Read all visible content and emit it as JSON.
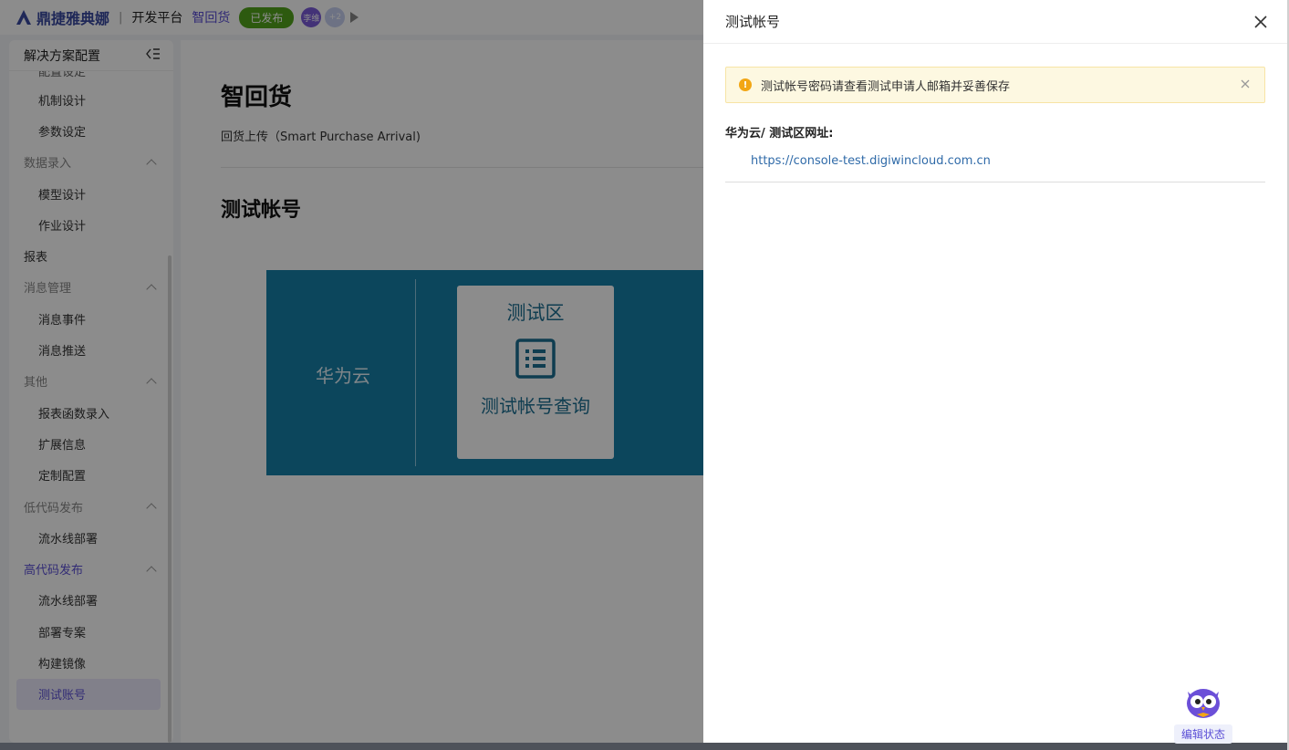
{
  "topbar": {
    "logo_text": "鼎捷雅典娜",
    "separator": "|",
    "platform": "开发平台",
    "app_name": "智回货",
    "status_badge": "已发布",
    "avatar_name": "李维",
    "avatar_more": "+2"
  },
  "sidebar": {
    "header": "解决方案配置",
    "partial_item": "配置设定",
    "items": [
      {
        "kind": "item",
        "label": "机制设计"
      },
      {
        "kind": "item",
        "label": "参数设定"
      },
      {
        "kind": "group",
        "label": "数据录入"
      },
      {
        "kind": "item",
        "label": "模型设计"
      },
      {
        "kind": "item",
        "label": "作业设计"
      },
      {
        "kind": "top",
        "label": "报表"
      },
      {
        "kind": "group",
        "label": "消息管理"
      },
      {
        "kind": "item",
        "label": "消息事件"
      },
      {
        "kind": "item",
        "label": "消息推送"
      },
      {
        "kind": "group",
        "label": "其他"
      },
      {
        "kind": "item",
        "label": "报表函数录入"
      },
      {
        "kind": "item",
        "label": "扩展信息"
      },
      {
        "kind": "item",
        "label": "定制配置"
      },
      {
        "kind": "group",
        "label": "低代码发布"
      },
      {
        "kind": "item",
        "label": "流水线部署"
      },
      {
        "kind": "group",
        "label": "高代码发布",
        "active": true
      },
      {
        "kind": "item",
        "label": "流水线部署"
      },
      {
        "kind": "item",
        "label": "部署专案"
      },
      {
        "kind": "item",
        "label": "构建镜像"
      },
      {
        "kind": "item",
        "label": "测试账号",
        "selected": true
      }
    ]
  },
  "main": {
    "title": "智回货",
    "subtitle": "回货上传（Smart Purchase Arrival)",
    "section_title": "测试帐号",
    "banner": {
      "label": "华为云",
      "card_title": "测试区",
      "card_icon": "list-document-icon",
      "card_label": "测试帐号查询"
    }
  },
  "drawer": {
    "title": "测试帐号",
    "alert_text": "测试帐号密码请查看测试申请人邮箱并妥善保存",
    "alert_icon": "!",
    "field_label": "华为云/ 测试区网址:",
    "link": "https://console-test.digiwincloud.com.cn",
    "mascot_label": "编辑状态"
  },
  "colors": {
    "accent": "#5b4fd6",
    "published": "#52a51d",
    "banner": "#1780a8",
    "alert_bg": "#fdf8e1",
    "link": "#2f6aa8"
  }
}
